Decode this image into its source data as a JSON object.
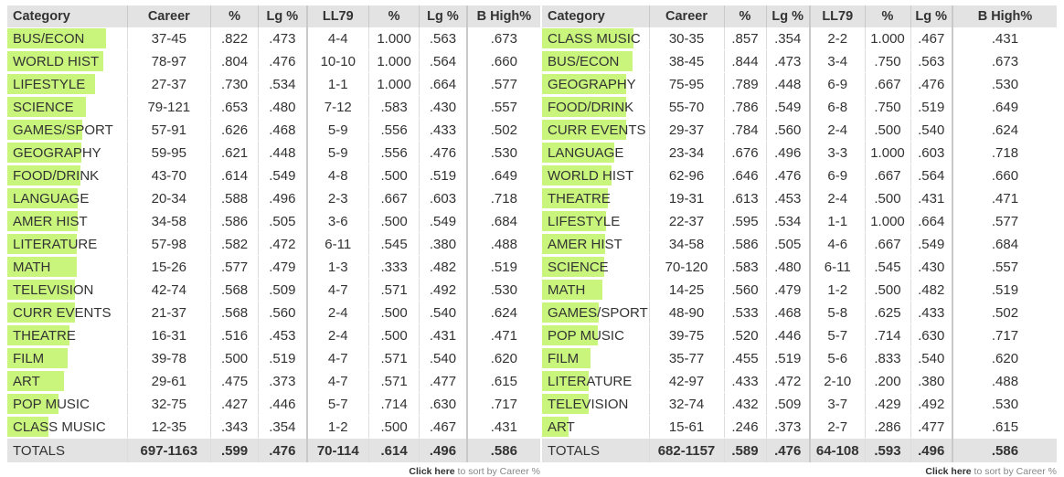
{
  "headers": [
    "Category",
    "Career",
    "%",
    "Lg %",
    "LL79",
    "%",
    "Lg %",
    "B High%"
  ],
  "sort_note": {
    "link": "Click here",
    "rest": "to sort by Career %"
  },
  "bar_color": "#c9f57d",
  "left": {
    "rows": [
      {
        "cat": "BUS/ECON",
        "career": "37-45",
        "pct": ".822",
        "lg": ".473",
        "ll": "4-4",
        "llpct": "1.000",
        "lllg": ".563",
        "bhigh": ".673"
      },
      {
        "cat": "WORLD HIST",
        "career": "78-97",
        "pct": ".804",
        "lg": ".476",
        "ll": "10-10",
        "llpct": "1.000",
        "lllg": ".564",
        "bhigh": ".660"
      },
      {
        "cat": "LIFESTYLE",
        "career": "27-37",
        "pct": ".730",
        "lg": ".534",
        "ll": "1-1",
        "llpct": "1.000",
        "lllg": ".664",
        "bhigh": ".577"
      },
      {
        "cat": "SCIENCE",
        "career": "79-121",
        "pct": ".653",
        "lg": ".480",
        "ll": "7-12",
        "llpct": ".583",
        "lllg": ".430",
        "bhigh": ".557"
      },
      {
        "cat": "GAMES/SPORT",
        "career": "57-91",
        "pct": ".626",
        "lg": ".468",
        "ll": "5-9",
        "llpct": ".556",
        "lllg": ".433",
        "bhigh": ".502"
      },
      {
        "cat": "GEOGRAPHY",
        "career": "59-95",
        "pct": ".621",
        "lg": ".448",
        "ll": "5-9",
        "llpct": ".556",
        "lllg": ".476",
        "bhigh": ".530"
      },
      {
        "cat": "FOOD/DRINK",
        "career": "43-70",
        "pct": ".614",
        "lg": ".549",
        "ll": "4-8",
        "llpct": ".500",
        "lllg": ".519",
        "bhigh": ".649"
      },
      {
        "cat": "LANGUAGE",
        "career": "20-34",
        "pct": ".588",
        "lg": ".496",
        "ll": "2-3",
        "llpct": ".667",
        "lllg": ".603",
        "bhigh": ".718"
      },
      {
        "cat": "AMER HIST",
        "career": "34-58",
        "pct": ".586",
        "lg": ".505",
        "ll": "3-6",
        "llpct": ".500",
        "lllg": ".549",
        "bhigh": ".684"
      },
      {
        "cat": "LITERATURE",
        "career": "57-98",
        "pct": ".582",
        "lg": ".472",
        "ll": "6-11",
        "llpct": ".545",
        "lllg": ".380",
        "bhigh": ".488"
      },
      {
        "cat": "MATH",
        "career": "15-26",
        "pct": ".577",
        "lg": ".479",
        "ll": "1-3",
        "llpct": ".333",
        "lllg": ".482",
        "bhigh": ".519"
      },
      {
        "cat": "TELEVISION",
        "career": "42-74",
        "pct": ".568",
        "lg": ".509",
        "ll": "4-7",
        "llpct": ".571",
        "lllg": ".492",
        "bhigh": ".530"
      },
      {
        "cat": "CURR EVENTS",
        "career": "21-37",
        "pct": ".568",
        "lg": ".560",
        "ll": "2-4",
        "llpct": ".500",
        "lllg": ".540",
        "bhigh": ".624"
      },
      {
        "cat": "THEATRE",
        "career": "16-31",
        "pct": ".516",
        "lg": ".453",
        "ll": "2-4",
        "llpct": ".500",
        "lllg": ".431",
        "bhigh": ".471"
      },
      {
        "cat": "FILM",
        "career": "39-78",
        "pct": ".500",
        "lg": ".519",
        "ll": "4-7",
        "llpct": ".571",
        "lllg": ".540",
        "bhigh": ".620"
      },
      {
        "cat": "ART",
        "career": "29-61",
        "pct": ".475",
        "lg": ".373",
        "ll": "4-7",
        "llpct": ".571",
        "lllg": ".477",
        "bhigh": ".615"
      },
      {
        "cat": "POP MUSIC",
        "career": "32-75",
        "pct": ".427",
        "lg": ".446",
        "ll": "5-7",
        "llpct": ".714",
        "lllg": ".630",
        "bhigh": ".717"
      },
      {
        "cat": "CLASS MUSIC",
        "career": "12-35",
        "pct": ".343",
        "lg": ".354",
        "ll": "1-2",
        "llpct": ".500",
        "lllg": ".467",
        "bhigh": ".431"
      }
    ],
    "totals": {
      "cat": "TOTALS",
      "career": "697-1163",
      "pct": ".599",
      "lg": ".476",
      "ll": "70-114",
      "llpct": ".614",
      "lllg": ".496",
      "bhigh": ".586"
    }
  },
  "right": {
    "rows": [
      {
        "cat": "CLASS MUSIC",
        "career": "30-35",
        "pct": ".857",
        "lg": ".354",
        "ll": "2-2",
        "llpct": "1.000",
        "lllg": ".467",
        "bhigh": ".431"
      },
      {
        "cat": "BUS/ECON",
        "career": "38-45",
        "pct": ".844",
        "lg": ".473",
        "ll": "3-4",
        "llpct": ".750",
        "lllg": ".563",
        "bhigh": ".673"
      },
      {
        "cat": "GEOGRAPHY",
        "career": "75-95",
        "pct": ".789",
        "lg": ".448",
        "ll": "6-9",
        "llpct": ".667",
        "lllg": ".476",
        "bhigh": ".530"
      },
      {
        "cat": "FOOD/DRINK",
        "career": "55-70",
        "pct": ".786",
        "lg": ".549",
        "ll": "6-8",
        "llpct": ".750",
        "lllg": ".519",
        "bhigh": ".649"
      },
      {
        "cat": "CURR EVENTS",
        "career": "29-37",
        "pct": ".784",
        "lg": ".560",
        "ll": "2-4",
        "llpct": ".500",
        "lllg": ".540",
        "bhigh": ".624"
      },
      {
        "cat": "LANGUAGE",
        "career": "23-34",
        "pct": ".676",
        "lg": ".496",
        "ll": "3-3",
        "llpct": "1.000",
        "lllg": ".603",
        "bhigh": ".718"
      },
      {
        "cat": "WORLD HIST",
        "career": "62-96",
        "pct": ".646",
        "lg": ".476",
        "ll": "6-9",
        "llpct": ".667",
        "lllg": ".564",
        "bhigh": ".660"
      },
      {
        "cat": "THEATRE",
        "career": "19-31",
        "pct": ".613",
        "lg": ".453",
        "ll": "2-4",
        "llpct": ".500",
        "lllg": ".431",
        "bhigh": ".471"
      },
      {
        "cat": "LIFESTYLE",
        "career": "22-37",
        "pct": ".595",
        "lg": ".534",
        "ll": "1-1",
        "llpct": "1.000",
        "lllg": ".664",
        "bhigh": ".577"
      },
      {
        "cat": "AMER HIST",
        "career": "34-58",
        "pct": ".586",
        "lg": ".505",
        "ll": "4-6",
        "llpct": ".667",
        "lllg": ".549",
        "bhigh": ".684"
      },
      {
        "cat": "SCIENCE",
        "career": "70-120",
        "pct": ".583",
        "lg": ".480",
        "ll": "6-11",
        "llpct": ".545",
        "lllg": ".430",
        "bhigh": ".557"
      },
      {
        "cat": "MATH",
        "career": "14-25",
        "pct": ".560",
        "lg": ".479",
        "ll": "1-2",
        "llpct": ".500",
        "lllg": ".482",
        "bhigh": ".519"
      },
      {
        "cat": "GAMES/SPORT",
        "career": "48-90",
        "pct": ".533",
        "lg": ".468",
        "ll": "5-8",
        "llpct": ".625",
        "lllg": ".433",
        "bhigh": ".502"
      },
      {
        "cat": "POP MUSIC",
        "career": "39-75",
        "pct": ".520",
        "lg": ".446",
        "ll": "5-7",
        "llpct": ".714",
        "lllg": ".630",
        "bhigh": ".717"
      },
      {
        "cat": "FILM",
        "career": "35-77",
        "pct": ".455",
        "lg": ".519",
        "ll": "5-6",
        "llpct": ".833",
        "lllg": ".540",
        "bhigh": ".620"
      },
      {
        "cat": "LITERATURE",
        "career": "42-97",
        "pct": ".433",
        "lg": ".472",
        "ll": "2-10",
        "llpct": ".200",
        "lllg": ".380",
        "bhigh": ".488"
      },
      {
        "cat": "TELEVISION",
        "career": "32-74",
        "pct": ".432",
        "lg": ".509",
        "ll": "3-7",
        "llpct": ".429",
        "lllg": ".492",
        "bhigh": ".530"
      },
      {
        "cat": "ART",
        "career": "15-61",
        "pct": ".246",
        "lg": ".373",
        "ll": "2-7",
        "llpct": ".286",
        "lllg": ".477",
        "bhigh": ".615"
      }
    ],
    "totals": {
      "cat": "TOTALS",
      "career": "682-1157",
      "pct": ".589",
      "lg": ".476",
      "ll": "64-108",
      "llpct": ".593",
      "lllg": ".496",
      "bhigh": ".586"
    }
  }
}
